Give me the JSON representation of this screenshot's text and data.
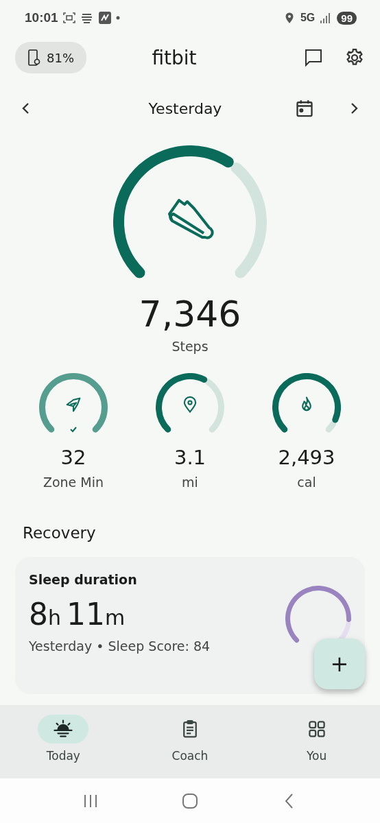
{
  "status_bar": {
    "time": "10:01",
    "network": "5G",
    "battery": "99"
  },
  "header": {
    "device_battery": "81%",
    "title": "fitbit"
  },
  "date_nav": {
    "label": "Yesterday"
  },
  "main_stat": {
    "value": "7,346",
    "label": "Steps"
  },
  "stats": [
    {
      "kind": "zone",
      "value": "32",
      "label": "Zone Min",
      "goal_met": true
    },
    {
      "kind": "distance",
      "value": "3.1",
      "label": "mi",
      "goal_met": false
    },
    {
      "kind": "calories",
      "value": "2,493",
      "label": "cal",
      "goal_met": false
    }
  ],
  "section_title": "Recovery",
  "sleep_card": {
    "title": "Sleep duration",
    "hours": "8",
    "hours_unit": "h",
    "minutes": "11",
    "minutes_unit": "m",
    "subtitle": "Yesterday • Sleep Score: 84"
  },
  "fab": {
    "label": "+"
  },
  "bottom_nav": [
    {
      "kind": "today",
      "label": "Today",
      "selected": true
    },
    {
      "kind": "coach",
      "label": "Coach",
      "selected": false
    },
    {
      "kind": "you",
      "label": "You",
      "selected": false
    }
  ]
}
